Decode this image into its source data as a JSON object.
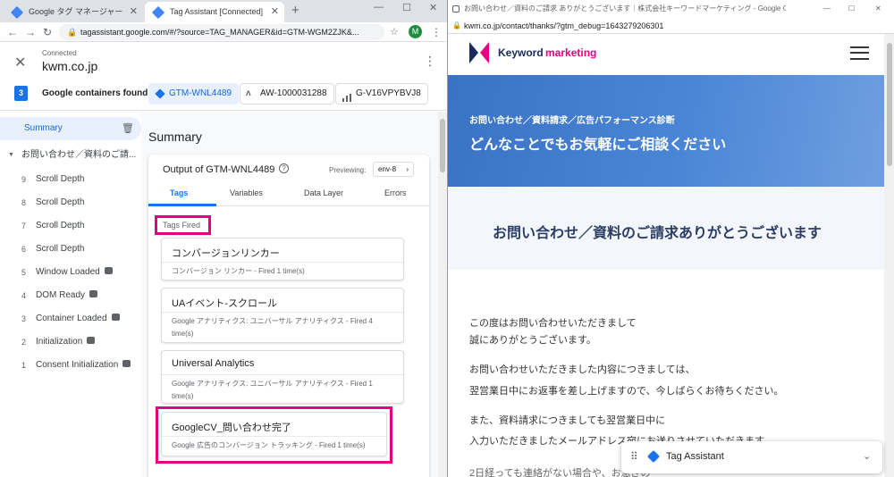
{
  "left_browser": {
    "tabs": [
      {
        "title": "Google タグ マネージャー",
        "active": false
      },
      {
        "title": "Tag Assistant [Connected]",
        "active": true
      }
    ],
    "new_tab": "+",
    "window_controls": [
      "—",
      "☐",
      "✕"
    ],
    "url": "tagassistant.google.com/#/?source=TAG_MANAGER&id=GTM-WGM2ZJK&...",
    "profile_initial": "M"
  },
  "header": {
    "status": "Connected",
    "domain": "kwm.co.jp"
  },
  "containers": {
    "count": "3",
    "label": "Google containers found",
    "items": [
      {
        "id": "GTM-WNL4489",
        "selected": true,
        "icon": "gtm-icon"
      },
      {
        "id": "AW-1000031288",
        "selected": false,
        "icon": "google-ads-icon"
      },
      {
        "id": "G-V16VPYBVJ8",
        "selected": false,
        "icon": "analytics-icon"
      }
    ]
  },
  "sidebar": {
    "summary": "Summary",
    "page_title": "お問い合わせ／資料のご請...",
    "events": [
      {
        "num": "9",
        "label": "Scroll Depth",
        "badge": false
      },
      {
        "num": "8",
        "label": "Scroll Depth",
        "badge": false
      },
      {
        "num": "7",
        "label": "Scroll Depth",
        "badge": false
      },
      {
        "num": "6",
        "label": "Scroll Depth",
        "badge": false
      },
      {
        "num": "5",
        "label": "Window Loaded",
        "badge": true
      },
      {
        "num": "4",
        "label": "DOM Ready",
        "badge": true
      },
      {
        "num": "3",
        "label": "Container Loaded",
        "badge": true
      },
      {
        "num": "2",
        "label": "Initialization",
        "badge": true
      },
      {
        "num": "1",
        "label": "Consent Initialization",
        "badge": true
      }
    ]
  },
  "summary": {
    "heading": "Summary",
    "output_title": "Output of GTM-WNL4489",
    "previewing_label": "Previewing:",
    "env": "env-8",
    "tabs": [
      "Tags",
      "Variables",
      "Data Layer",
      "Errors"
    ],
    "active_tab": "Tags",
    "section": "Tags Fired",
    "tags": [
      {
        "name": "コンバージョンリンカー",
        "desc": "コンバージョン リンカー - Fired 1 time(s)"
      },
      {
        "name": "UAイベント-スクロール",
        "desc": "Google アナリティクス: ユニバーサル アナリティクス - Fired 4 time(s)"
      },
      {
        "name": "Universal Analytics",
        "desc": "Google アナリティクス: ユニバーサル アナリティクス - Fired 1 time(s)"
      },
      {
        "name": "GoogleCV_問い合わせ完了",
        "desc": "Google 広告のコンバージョン トラッキング - Fired 1 time(s)"
      }
    ]
  },
  "right_browser": {
    "title": "お問い合わせ／資料のご請求 ありがとうございます｜株式会社キーワードマーケティング - Google Chrome",
    "url": "kwm.co.jp/contact/thanks/?gtm_debug=1643279206301",
    "window_controls": [
      "—",
      "☐",
      "✕"
    ]
  },
  "site": {
    "logo_word1": "Keyword",
    "logo_word2": "marketing",
    "hero_sub": "お問い合わせ／資料請求／広告パフォーマンス診断",
    "hero_title": "どんなことでもお気軽にご相談ください",
    "thanks_heading": "お問い合わせ／資料のご請求ありがとうございます",
    "paragraphs": [
      "この度はお問い合わせいただきまして",
      "誠にありがとうございます。",
      "お問い合わせいただきました内容につきましては、",
      "翌営業日中にお返事を差し上げますので、今しばらくお待ちください。",
      "また、資料請求につきましても翌営業日中に",
      "入力いただきましたメールアドレス宛にお送りさせていただきます。",
      "2日経っても連絡がない場合や、お急ぎの"
    ],
    "brand_pink": "#e4007f",
    "brand_navy": "#1a2a5e"
  },
  "tag_assistant_widget": {
    "label": "Tag Assistant"
  }
}
